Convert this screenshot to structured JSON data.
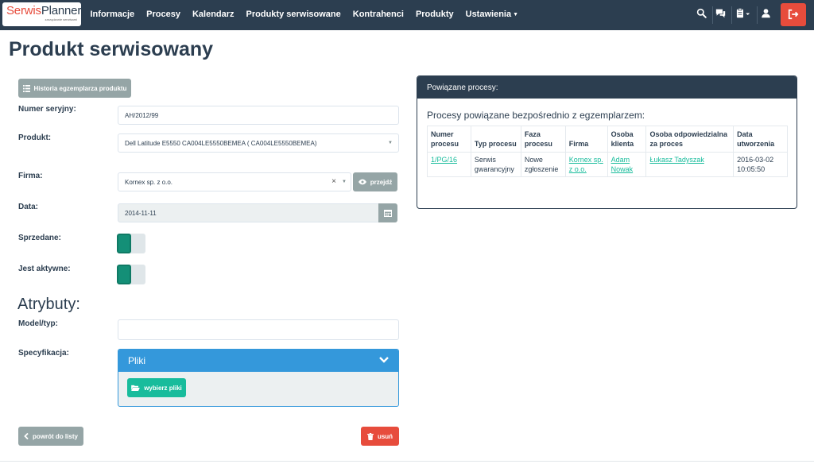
{
  "brand": {
    "name_part1": "Serwis",
    "name_part2": "Planner",
    "tagline": "zarządzanie serwisami"
  },
  "nav": {
    "items": [
      "Informacje",
      "Procesy",
      "Kalendarz",
      "Produkty serwisowane",
      "Kontrahenci",
      "Produkty",
      "Ustawienia"
    ],
    "right_icons": [
      "search-icon",
      "chat-icon",
      "clipboard-icon",
      "user-icon",
      "logout-icon"
    ]
  },
  "page": {
    "title": "Produkt serwisowany"
  },
  "history_button": "Historia egzemplarza produktu",
  "form": {
    "serial_label": "Numer seryjny:",
    "serial_value": "AH/2012/99",
    "product_label": "Produkt:",
    "product_value": "Dell Latitude E5550 CA004LE5550BEMEA ( CA004LE5550BEMEA)",
    "company_label": "Firma:",
    "company_value": "Kornex sp. z o.o.",
    "goto_button": "przejdź",
    "date_label": "Data:",
    "date_value": "2014-11-11",
    "sold_label": "Sprzedane:",
    "sold_on": true,
    "active_label": "Jest aktywne:",
    "active_on": true
  },
  "attributes": {
    "title": "Atrybuty:",
    "model_label": "Model/typ:",
    "model_value": "",
    "spec_label": "Specyfikacja:"
  },
  "files": {
    "title": "Pliki",
    "choose_button": "wybierz pliki"
  },
  "actions": {
    "back_button": "powrót do listy",
    "delete_button": "usuń"
  },
  "related": {
    "panel_title": "Powiązane procesy:",
    "subtitle": "Procesy powiązane bezpośrednio z egzemplarzem:",
    "columns": [
      "Numer procesu",
      "Typ procesu",
      "Faza procesu",
      "Firma",
      "Osoba klienta",
      "Osoba odpowiedzialna za proces",
      "Data utworzenia"
    ],
    "rows": [
      [
        "1/PG/16",
        "Serwis gwarancyjny",
        "Nowe zgłoszenie",
        "Kornex sp. z o.o.",
        "Adam Nowak",
        "Łukasz Tadyszak",
        "2016-03-02 10:05:50"
      ]
    ]
  },
  "colors": {
    "navbar": "#2c3e50",
    "accent": "#18bc9c",
    "danger": "#e74c3c",
    "primary": "#3498db",
    "muted": "#95a5a6"
  }
}
